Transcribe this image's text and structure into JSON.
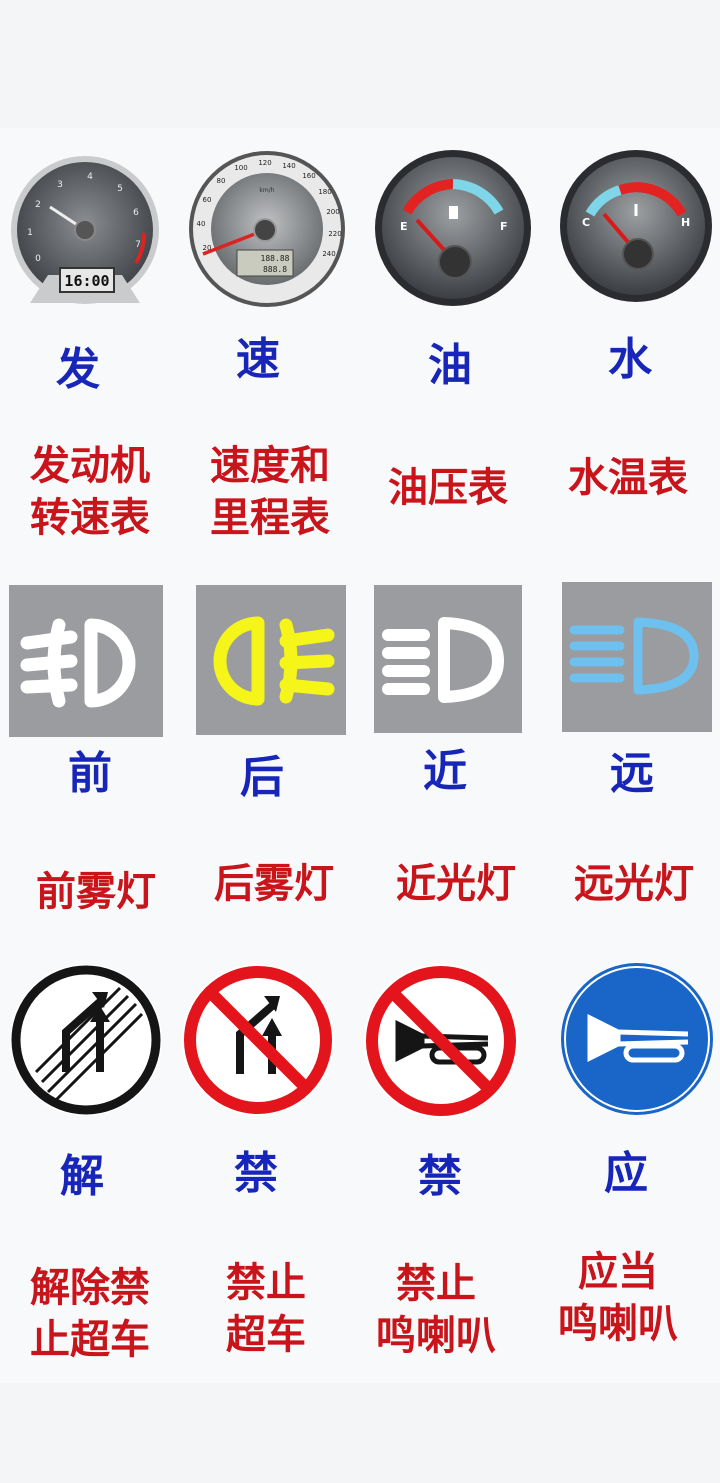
{
  "gauges": [
    {
      "char": "发",
      "desc": "发动机\n转速表",
      "display": "16:00",
      "ticks": [
        "0",
        "1",
        "2",
        "3",
        "4",
        "5",
        "6",
        "7"
      ]
    },
    {
      "char": "速",
      "desc": "速度和\n里程表",
      "ticks": [
        "20",
        "40",
        "60",
        "80",
        "100",
        "120",
        "140",
        "160",
        "180",
        "200",
        "220",
        "240"
      ],
      "unit": "km/h",
      "odo1": "188.88",
      "odo2": "888.8"
    },
    {
      "char": "油",
      "desc": "油压表",
      "left": "E",
      "right": "F"
    },
    {
      "char": "水",
      "desc": "水温表",
      "left": "C",
      "right": "H"
    }
  ],
  "lights": [
    {
      "char": "前",
      "desc": "前雾灯",
      "icon_color": "#ffffff"
    },
    {
      "char": "后",
      "desc": "后雾灯",
      "icon_color": "#f5f51a"
    },
    {
      "char": "近",
      "desc": "近光灯",
      "icon_color": "#ffffff"
    },
    {
      "char": "远",
      "desc": "远光灯",
      "icon_color": "#6ec0ef"
    }
  ],
  "signs": [
    {
      "char": "解",
      "desc": "解除禁\n止超车"
    },
    {
      "char": "禁",
      "desc": "禁止\n超车"
    },
    {
      "char": "禁",
      "desc": "禁止\n鸣喇叭"
    },
    {
      "char": "应",
      "desc": "应当\n鸣喇叭"
    }
  ],
  "colors": {
    "char": "#1726b8",
    "desc": "#c8141a",
    "sign_red": "#e3141b",
    "sign_blue": "#1966c8"
  }
}
